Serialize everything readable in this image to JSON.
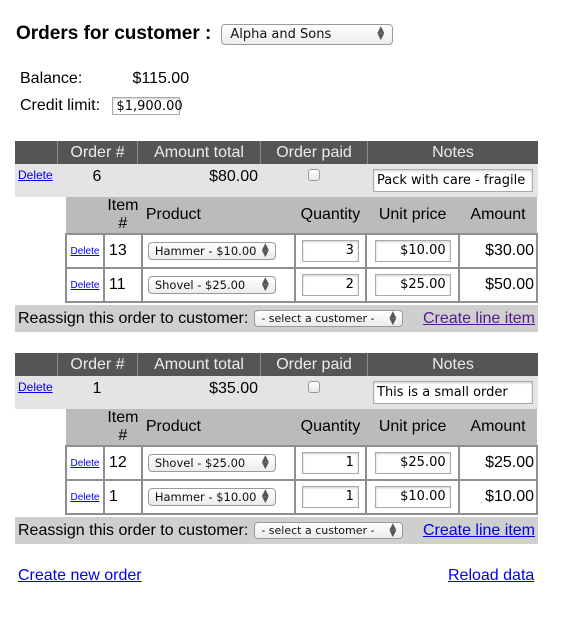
{
  "header": {
    "title": "Orders for customer :",
    "customer_select": "Alpha and Sons"
  },
  "summary": {
    "balance_label": "Balance:",
    "balance_value": "$115.00",
    "credit_label": "Credit limit:",
    "credit_value": "$1,900.00"
  },
  "order_columns": [
    "",
    "Order #",
    "Amount total",
    "Order paid",
    "Notes"
  ],
  "item_columns": [
    "",
    "Item #",
    "Product",
    "Quantity",
    "Unit price",
    "Amount"
  ],
  "orders": [
    {
      "delete_label": "Delete",
      "order_number": "6",
      "amount_total": "$80.00",
      "paid": false,
      "notes": "Pack with care - fragile",
      "items": [
        {
          "delete_label": "Delete",
          "item_number": "13",
          "product": "Hammer - $10.00",
          "quantity": "3",
          "unit_price": "$10.00",
          "amount": "$30.00"
        },
        {
          "delete_label": "Delete",
          "item_number": "11",
          "product": "Shovel - $25.00",
          "quantity": "2",
          "unit_price": "$25.00",
          "amount": "$50.00"
        }
      ],
      "reassign_label": "Reassign this order to customer:",
      "reassign_select": "- select a customer -",
      "create_line_item": "Create line item"
    },
    {
      "delete_label": "Delete",
      "order_number": "1",
      "amount_total": "$35.00",
      "paid": false,
      "notes": "This is a small order",
      "items": [
        {
          "delete_label": "Delete",
          "item_number": "12",
          "product": "Shovel - $25.00",
          "quantity": "1",
          "unit_price": "$25.00",
          "amount": "$25.00"
        },
        {
          "delete_label": "Delete",
          "item_number": "1",
          "product": "Hammer - $10.00",
          "quantity": "1",
          "unit_price": "$10.00",
          "amount": "$10.00"
        }
      ],
      "reassign_label": "Reassign this order to customer:",
      "reassign_select": "- select a customer -",
      "create_line_item": "Create line item"
    }
  ],
  "footer": {
    "create_new_order": "Create new order",
    "reload_data": "Reload data"
  },
  "colors": {
    "order_header_bg": "#555555",
    "order_row_bg": "#e4e4e4",
    "item_header_bg": "#bbbbbb",
    "reassign_bg": "#cfcfcf",
    "link": "#0000ee",
    "visited_link": "#551a8b"
  }
}
